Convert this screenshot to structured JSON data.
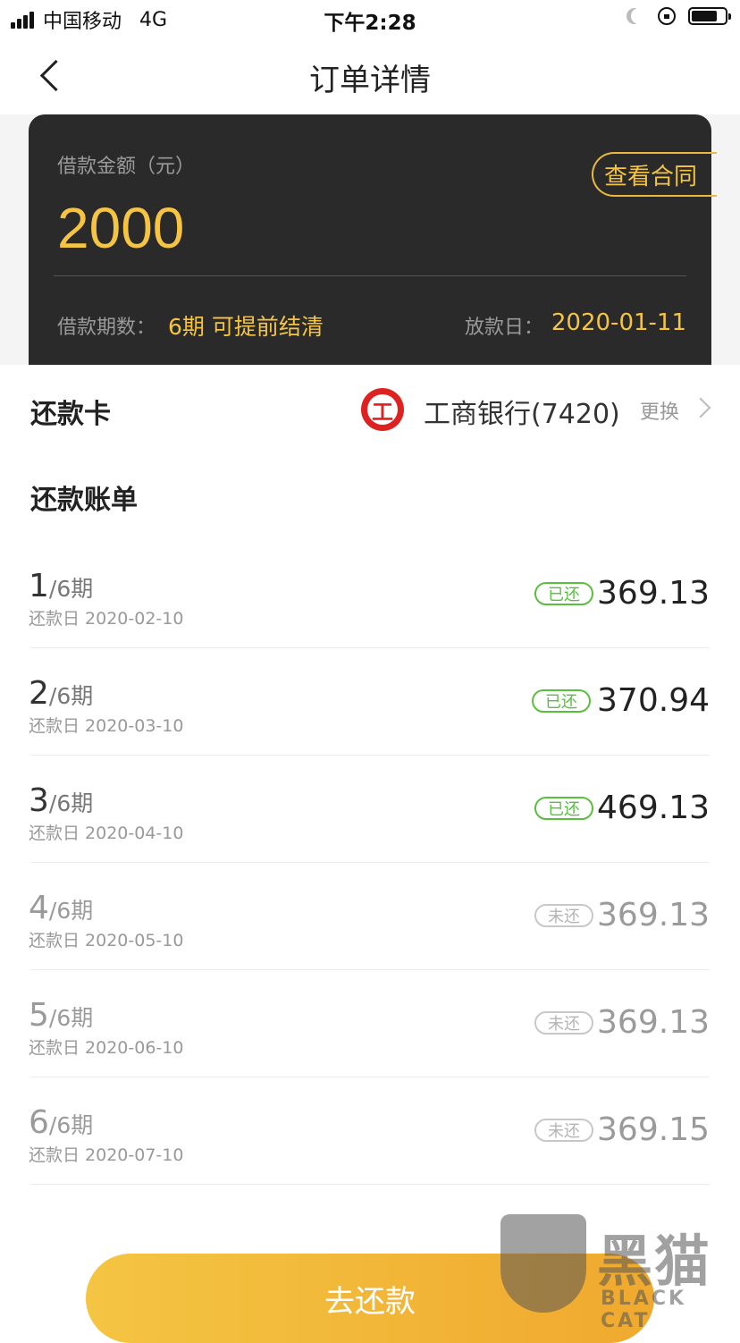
{
  "status_bar": {
    "carrier": "中国移动",
    "network": "4G",
    "time": "下午2:28"
  },
  "nav": {
    "title": "订单详情"
  },
  "loan": {
    "amount_label": "借款金额（元）",
    "amount": "2000",
    "contract_button": "查看合同",
    "terms_label": "借款期数：",
    "terms_value": "6期 可提前结清",
    "date_label": "放款日：",
    "date_value": "2020-01-11"
  },
  "repay_card": {
    "label": "还款卡",
    "bank_name": "工商银行(7420)",
    "change_label": "更换"
  },
  "bill": {
    "title": "还款账单",
    "installments": [
      {
        "num": "1",
        "total": "/6期",
        "due": "还款日 2020-02-10",
        "status": "已还",
        "amount": "369.13"
      },
      {
        "num": "2",
        "total": "/6期",
        "due": "还款日 2020-03-10",
        "status": "已还",
        "amount": "370.94"
      },
      {
        "num": "3",
        "total": "/6期",
        "due": "还款日 2020-04-10",
        "status": "已还",
        "amount": "469.13"
      },
      {
        "num": "4",
        "total": "/6期",
        "due": "还款日 2020-05-10",
        "status": "未还",
        "amount": "369.13"
      },
      {
        "num": "5",
        "total": "/6期",
        "due": "还款日 2020-06-10",
        "status": "未还",
        "amount": "369.13"
      },
      {
        "num": "6",
        "total": "/6期",
        "due": "还款日 2020-07-10",
        "status": "未还",
        "amount": "369.15"
      }
    ]
  },
  "pay_button": "去还款",
  "watermark": {
    "text": "黑猫",
    "sub": "BLACK CAT"
  },
  "colors": {
    "accent": "#f5c443",
    "paid": "#59c03e",
    "card_bg": "#2a2a2a"
  }
}
